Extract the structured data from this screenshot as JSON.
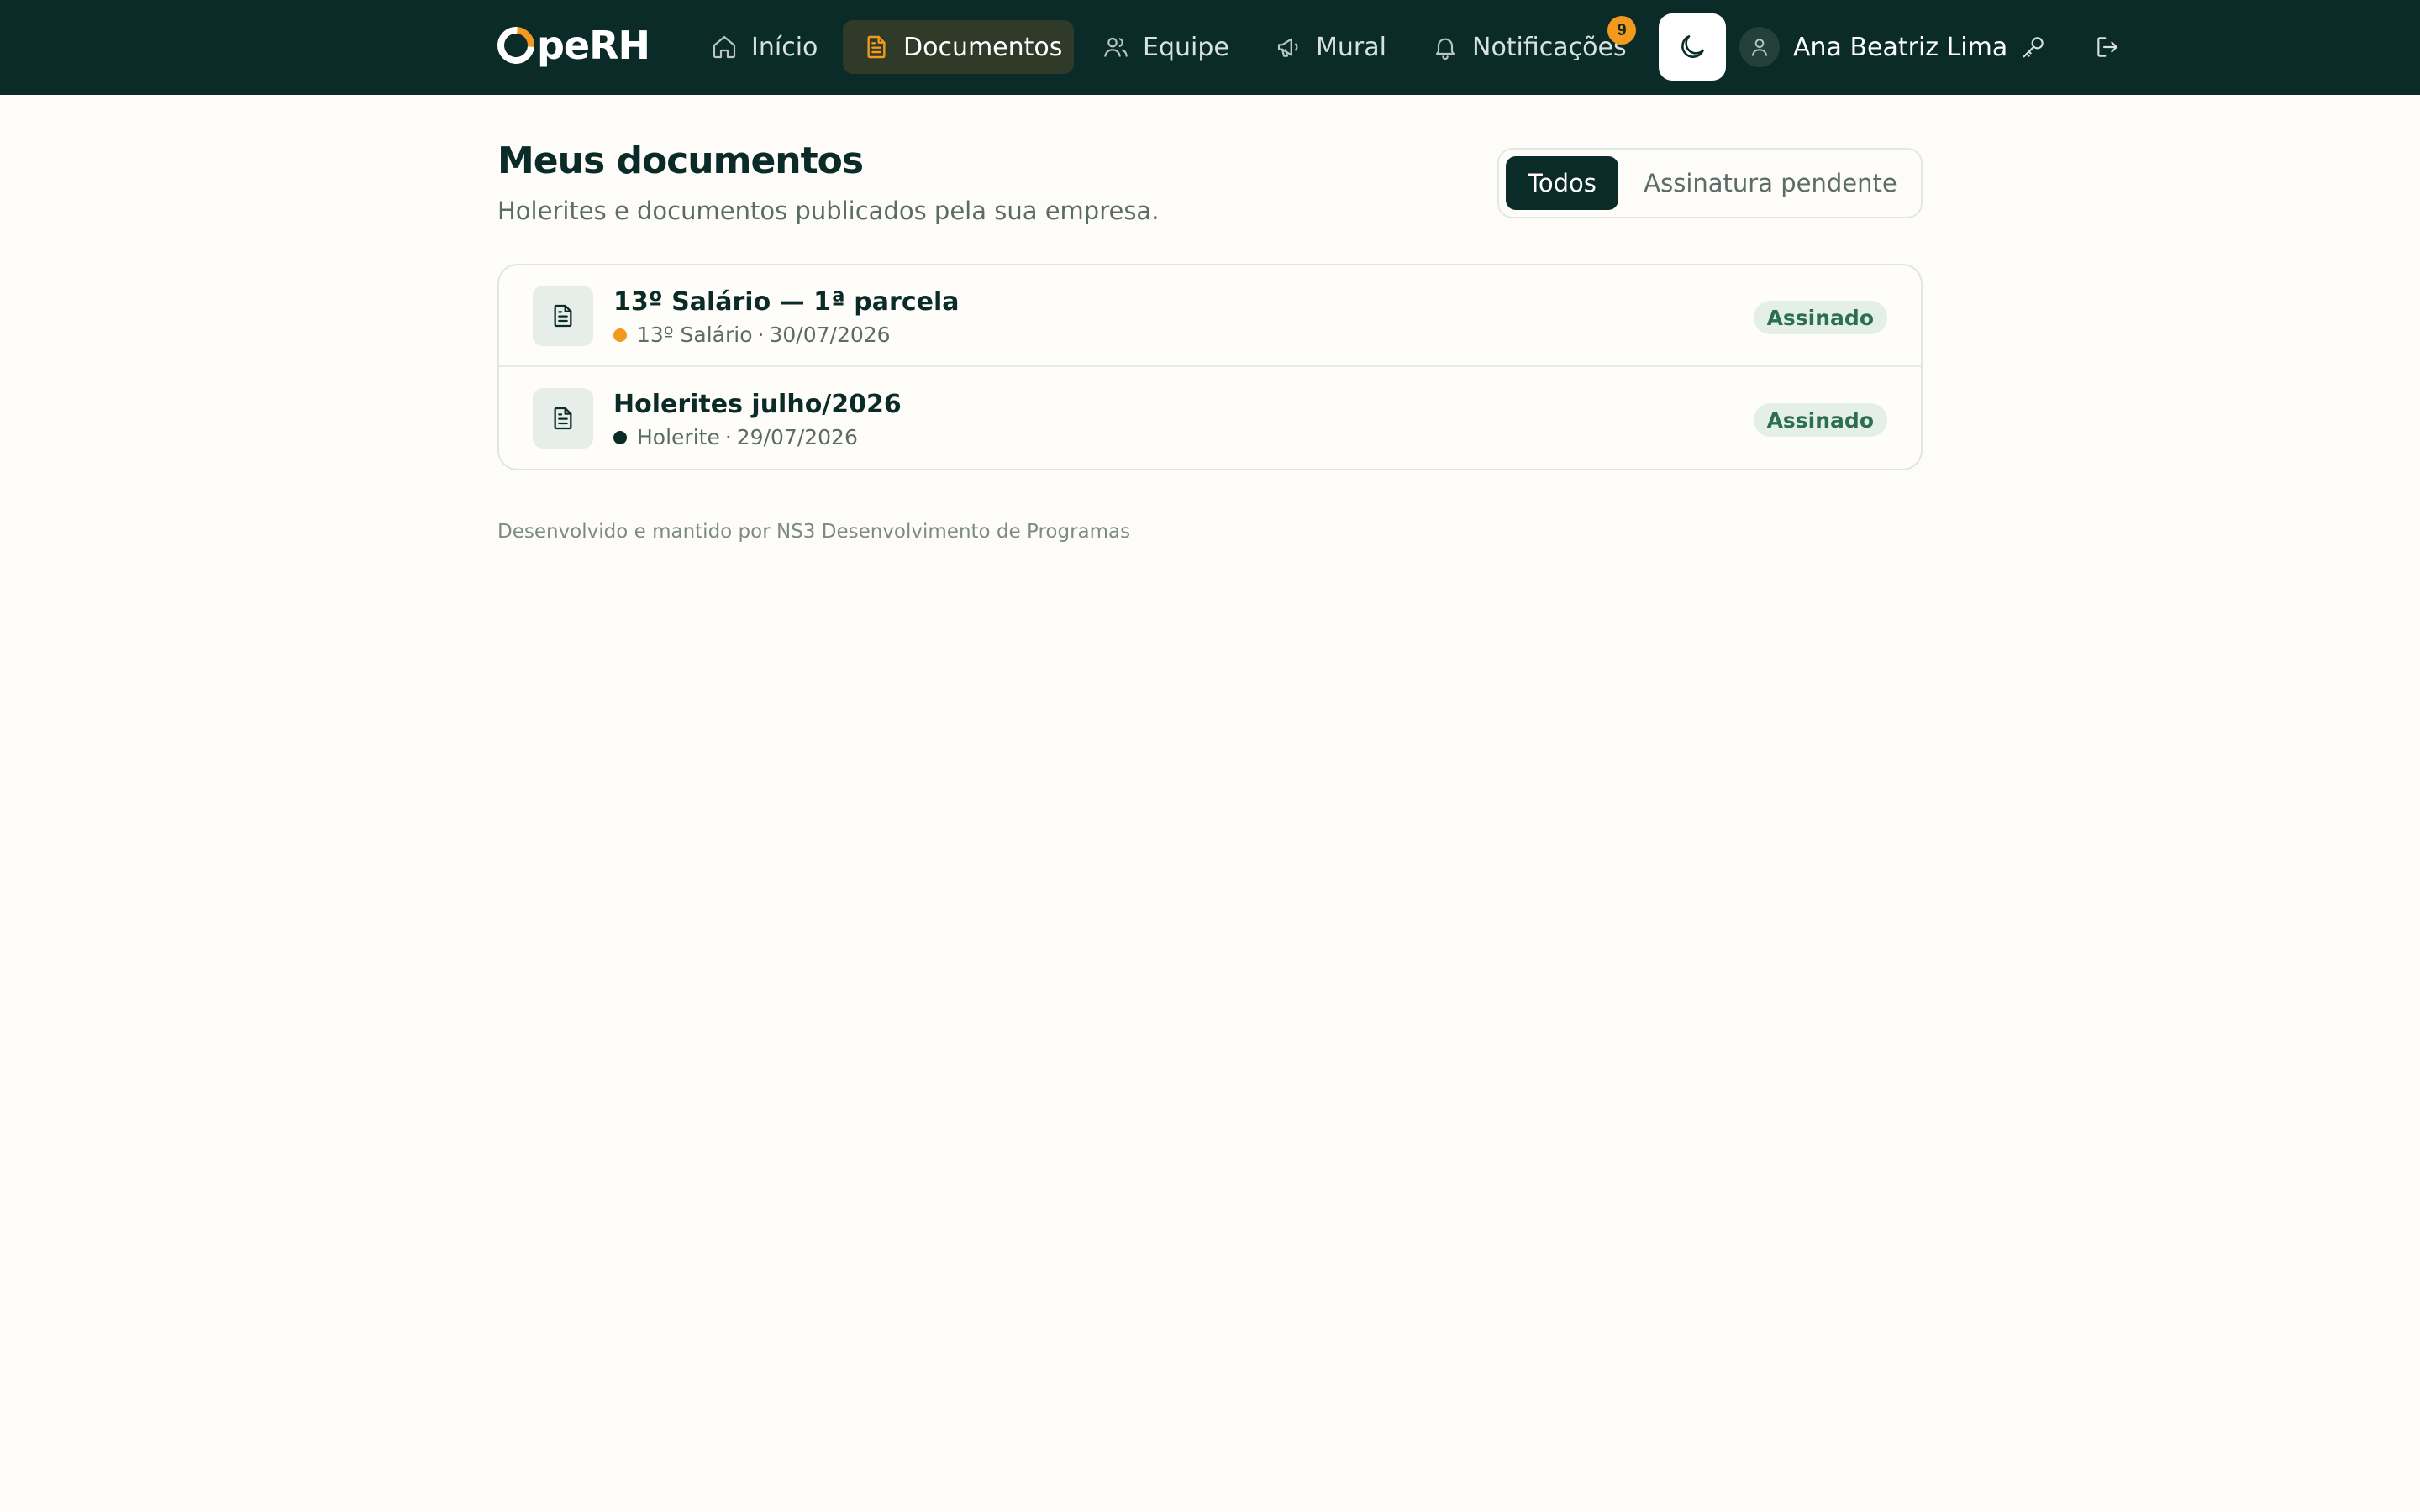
{
  "app": {
    "logo_text": "peRH",
    "brand_colors": {
      "nav_bg": "#0a2b27",
      "accent": "#f39a1e",
      "page_bg": "#fdfcf8"
    }
  },
  "nav": {
    "items": [
      {
        "label": "Início",
        "icon": "home-icon"
      },
      {
        "label": "Documentos",
        "icon": "document-icon",
        "active": true
      },
      {
        "label": "Equipe",
        "icon": "users-icon"
      },
      {
        "label": "Mural",
        "icon": "megaphone-icon"
      },
      {
        "label": "Notificações",
        "icon": "bell-icon"
      }
    ],
    "notification_count": "9",
    "theme_toggle_icon": "moon-icon",
    "user_name": "Ana Beatriz Lima",
    "key_icon": "key-icon",
    "logout_icon": "logout-icon"
  },
  "page": {
    "title": "Meus documentos",
    "subtitle": "Holerites e documentos publicados pela sua empresa."
  },
  "filters": {
    "all_label": "Todos",
    "pending_label": "Assinatura pendente",
    "selected": "Todos"
  },
  "documents": [
    {
      "title": "13º Salário — 1ª parcela",
      "category": "13º Salário",
      "date": "30/07/2026",
      "category_color": "#f39a1e",
      "status": "Assinado"
    },
    {
      "title": "Holerites julho/2026",
      "category": "Holerite",
      "date": "29/07/2026",
      "category_color": "#0a2b27",
      "status": "Assinado"
    }
  ],
  "footer": {
    "text": "Desenvolvido e mantido por NS3 Desenvolvimento de Programas"
  }
}
